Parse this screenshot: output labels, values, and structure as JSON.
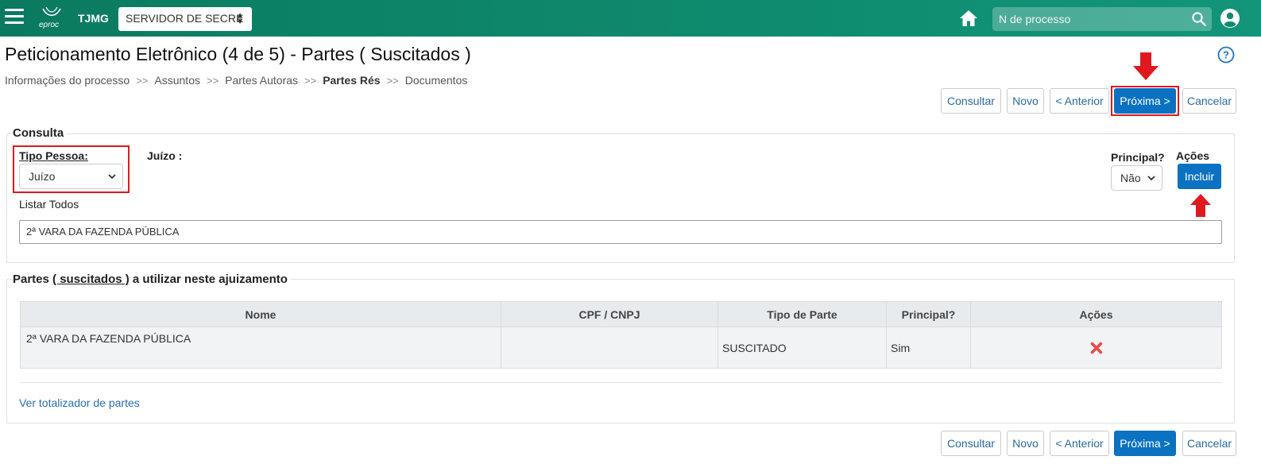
{
  "header": {
    "logo_text": "eproc",
    "org": "TJMG",
    "server_select": "SERVIDOR DE SECRE",
    "search_placeholder": "N de processo"
  },
  "page": {
    "title": "Peticionamento Eletrônico (4 de 5) - Partes ( Suscitados )",
    "breadcrumb": [
      "Informações do processo",
      "Assuntos",
      "Partes Autoras",
      "Partes Rés",
      "Documentos"
    ],
    "breadcrumb_separator": ">>"
  },
  "buttons": {
    "consultar": "Consultar",
    "novo": "Novo",
    "anterior": "< Anterior",
    "proxima": "Próxima >",
    "cancelar": "Cancelar"
  },
  "consulta": {
    "legend": "Consulta",
    "tipo_pessoa_label": "Tipo Pessoa:",
    "tipo_pessoa_value": "Juízo",
    "juizo_label": "Juízo :",
    "principal_label": "Principal?",
    "principal_value": "Não",
    "acoes_label": "Ações",
    "incluir_button": "Incluir",
    "listar_todos": "Listar Todos",
    "selected_text": "2ª VARA DA FAZENDA PÚBLICA"
  },
  "partes": {
    "legend_prefix": "Partes ",
    "legend_link": "( suscitados )",
    "legend_suffix": " a utilizar neste ajuizamento",
    "columns": [
      "Nome",
      "CPF / CNPJ",
      "Tipo de Parte",
      "Principal?",
      "Ações"
    ],
    "rows": [
      {
        "nome": "2ª VARA DA FAZENDA PÚBLICA",
        "cpf_cnpj": "",
        "tipo": "SUSCITADO",
        "principal": "Sim",
        "acao": "remove-icon"
      }
    ],
    "totalizador_link": "Ver totalizador de partes"
  },
  "colors": {
    "header": "#0e8a6d",
    "primary": "#0b72c2",
    "highlight": "#e0191f",
    "delete": "#e84a4a"
  }
}
